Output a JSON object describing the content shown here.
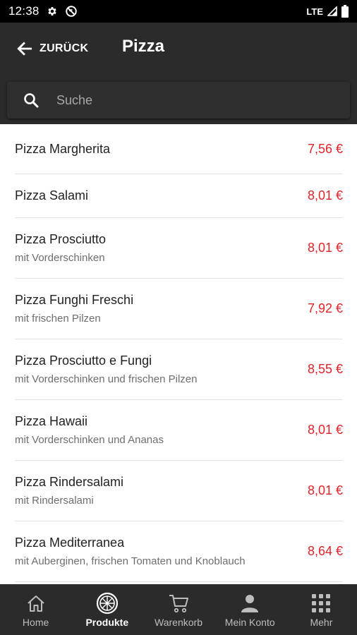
{
  "status_bar": {
    "time": "12:38",
    "network": "LTE",
    "icons": [
      "gear-icon",
      "no-sync-icon",
      "signal-icon",
      "battery-icon"
    ]
  },
  "header": {
    "back_label": "ZURÜCK",
    "title": "Pizza",
    "search_placeholder": "Suche",
    "search_value": ""
  },
  "colors": {
    "header_bg": "#2b2b2b",
    "price": "#e0242a",
    "divider": "#e3e3e3"
  },
  "products": [
    {
      "name": "Pizza Margherita",
      "description": "",
      "price": "7,56 €"
    },
    {
      "name": "Pizza Salami",
      "description": "",
      "price": "8,01 €"
    },
    {
      "name": "Pizza Prosciutto",
      "description": "mit Vorderschinken",
      "price": "8,01 €"
    },
    {
      "name": "Pizza Funghi Freschi",
      "description": "mit frischen Pilzen",
      "price": "7,92 €"
    },
    {
      "name": "Pizza Prosciutto e Fungi",
      "description": "mit Vorderschinken und frischen Pilzen",
      "price": "8,55 €"
    },
    {
      "name": "Pizza Hawaii",
      "description": "mit Vorderschinken und Ananas",
      "price": "8,01 €"
    },
    {
      "name": "Pizza Rindersalami",
      "description": "mit Rindersalami",
      "price": "8,01 €"
    },
    {
      "name": "Pizza Mediterranea",
      "description": "mit Auberginen, frischen Tomaten und Knoblauch",
      "price": "8,64 €"
    }
  ],
  "bottom_nav": [
    {
      "label": "Home",
      "icon": "home-icon",
      "active": false
    },
    {
      "label": "Produkte",
      "icon": "pizza-icon",
      "active": true
    },
    {
      "label": "Warenkorb",
      "icon": "cart-icon",
      "active": false
    },
    {
      "label": "Mein Konto",
      "icon": "account-icon",
      "active": false
    },
    {
      "label": "Mehr",
      "icon": "grid-icon",
      "active": false
    }
  ]
}
